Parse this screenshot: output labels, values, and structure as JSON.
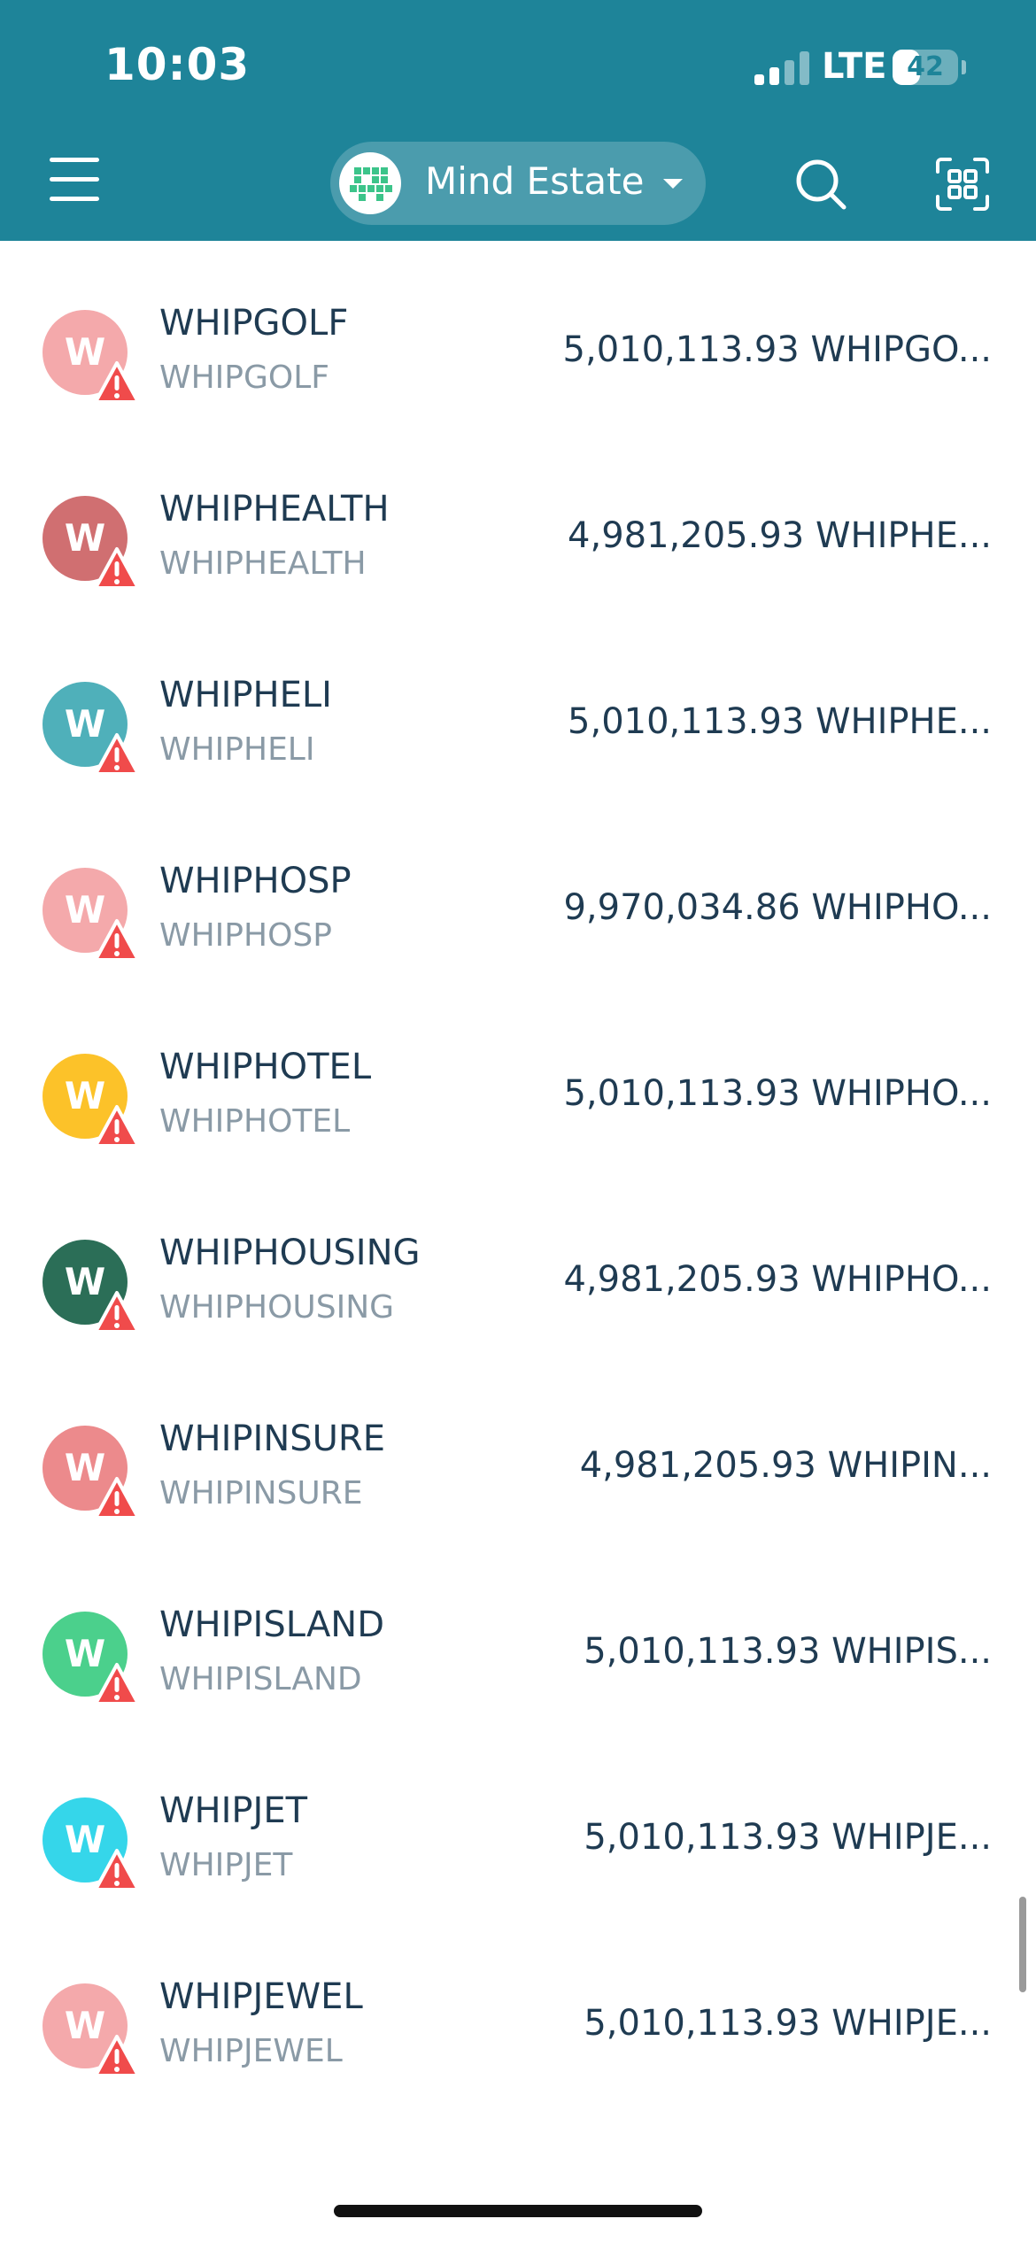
{
  "status_bar": {
    "time": "10:03",
    "network": "LTE",
    "battery": "42",
    "battery_fraction": 0.42
  },
  "header": {
    "menu_icon": "hamburger-menu-icon",
    "space_name": "Mind Estate",
    "space_avatar_icon": "pixel-avatar-icon",
    "search_icon": "search-icon",
    "scan_icon": "qr-scan-icon",
    "accent_color": "#1e8499"
  },
  "assets": [
    {
      "avatar_letter": "W",
      "avatar_color": "#f4a9ab",
      "name": "WHIPGOLF",
      "code": "WHIPGOLF",
      "amount": "5,010,113.93 WHIPGO..."
    },
    {
      "avatar_letter": "W",
      "avatar_color": "#d06f71",
      "name": "WHIPHEALTH",
      "code": "WHIPHEALTH",
      "amount": "4,981,205.93 WHIPHE..."
    },
    {
      "avatar_letter": "W",
      "avatar_color": "#4fb0ba",
      "name": "WHIPHELI",
      "code": "WHIPHELI",
      "amount": "5,010,113.93 WHIPHE..."
    },
    {
      "avatar_letter": "W",
      "avatar_color": "#f4a9ab",
      "name": "WHIPHOSP",
      "code": "WHIPHOSP",
      "amount": "9,970,034.86 WHIPHO..."
    },
    {
      "avatar_letter": "W",
      "avatar_color": "#fcc229",
      "name": "WHIPHOTEL",
      "code": "WHIPHOTEL",
      "amount": "5,010,113.93 WHIPHO..."
    },
    {
      "avatar_letter": "W",
      "avatar_color": "#2b6e57",
      "name": "WHIPHOUSING",
      "code": "WHIPHOUSING",
      "amount": "4,981,205.93 WHIPHO..."
    },
    {
      "avatar_letter": "W",
      "avatar_color": "#ec8a8c",
      "name": "WHIPINSURE",
      "code": "WHIPINSURE",
      "amount": "4,981,205.93 WHIPIN..."
    },
    {
      "avatar_letter": "W",
      "avatar_color": "#4bd08c",
      "name": "WHIPISLAND",
      "code": "WHIPISLAND",
      "amount": "5,010,113.93 WHIPIS..."
    },
    {
      "avatar_letter": "W",
      "avatar_color": "#35d6ea",
      "name": "WHIPJET",
      "code": "WHIPJET",
      "amount": "5,010,113.93 WHIPJE..."
    },
    {
      "avatar_letter": "W",
      "avatar_color": "#f4a9ab",
      "name": "WHIPJEWEL",
      "code": "WHIPJEWEL",
      "amount": "5,010,113.93 WHIPJE..."
    }
  ],
  "warning_icon": "warning-triangle-icon",
  "warning_color": "#f04b4b"
}
